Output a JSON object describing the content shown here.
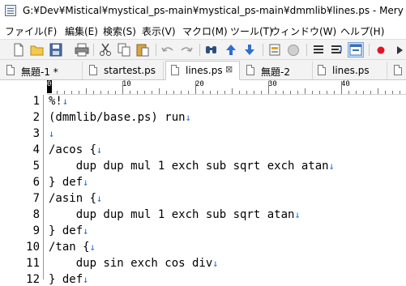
{
  "window": {
    "title": "G:¥Dev¥Mistical¥mystical_ps-main¥mystical_ps-main¥dmmlib¥lines.ps - Mery"
  },
  "menu": [
    {
      "label": "ファイル(F)"
    },
    {
      "label": "編集(E)"
    },
    {
      "label": "検索(S)"
    },
    {
      "label": "表示(V)"
    },
    {
      "label": "マクロ(M)"
    },
    {
      "label": "ツール(T)"
    },
    {
      "label": "ウィンドウ(W)"
    },
    {
      "label": "ヘルプ(H)"
    }
  ],
  "tabs": [
    {
      "label": "無題-1 *",
      "active": false
    },
    {
      "label": "startest.ps",
      "active": false
    },
    {
      "label": "lines.ps",
      "active": true,
      "close": "⊠"
    },
    {
      "label": "無題-2",
      "active": false
    },
    {
      "label": "lines.ps",
      "active": false
    }
  ],
  "ruler": {
    "marks": [
      "0",
      "10",
      "20",
      "30",
      "40"
    ]
  },
  "editor": {
    "eol_marker": "↓",
    "lines": [
      {
        "n": "1",
        "text": "%!"
      },
      {
        "n": "2",
        "text": "(dmmlib/base.ps) run"
      },
      {
        "n": "3",
        "text": ""
      },
      {
        "n": "4",
        "text": "/acos {"
      },
      {
        "n": "5",
        "text": "    dup dup mul 1 exch sub sqrt exch atan"
      },
      {
        "n": "6",
        "text": "} def"
      },
      {
        "n": "7",
        "text": "/asin {"
      },
      {
        "n": "8",
        "text": "    dup dup mul 1 exch sub sqrt atan"
      },
      {
        "n": "9",
        "text": "} def"
      },
      {
        "n": "10",
        "text": "/tan {"
      },
      {
        "n": "11",
        "text": "    dup sin exch cos div"
      },
      {
        "n": "12",
        "text": "} def"
      }
    ]
  },
  "colors": {
    "accent": "#1a6fd1",
    "record": "#e81123"
  }
}
